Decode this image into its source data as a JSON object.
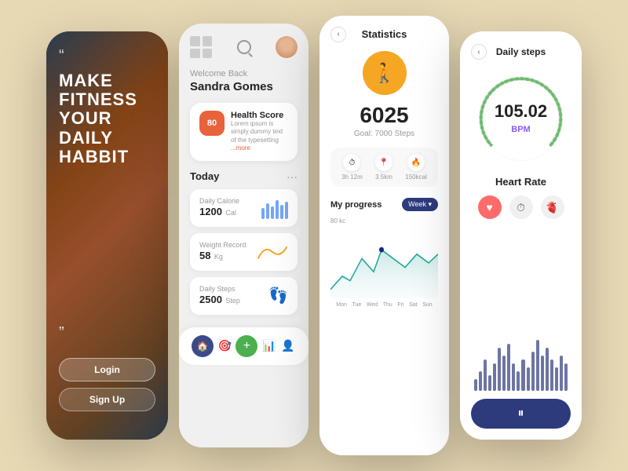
{
  "phone1": {
    "quote_open": "“",
    "quote_close": "”",
    "title_line1": "MAKE",
    "title_line2": "FITNESS",
    "title_line3": "YOUR DAILY",
    "title_line4": "HABBIT",
    "login_label": "Login",
    "signup_label": "Sign Up"
  },
  "phone2": {
    "welcome_text": "Welcome Back",
    "user_name": "Sandra Gomes",
    "health_score_value": "80",
    "health_title": "Health Score",
    "health_desc": "Lorem ipsum is simply dummy text of the typesetting",
    "more_link": "...more",
    "today_label": "Today",
    "calorie_label": "Daily Calorie",
    "calorie_value": "1200",
    "calorie_unit": "Cal",
    "weight_label": "Weight Record",
    "weight_value": "58",
    "weight_unit": "Kg",
    "steps_label": "Daily Steps",
    "steps_value": "2500",
    "steps_unit": "Step"
  },
  "phone3": {
    "title": "Statistics",
    "steps_count": "6025",
    "steps_goal": "Goal: 7000 Steps",
    "time_value": "3h 12m",
    "distance_value": "3.5km",
    "calories_value": "150kcal",
    "progress_title": "My progress",
    "week_label": "Week",
    "chart_value_label": "80 kc",
    "chart_days": [
      "Mon",
      "Tue",
      "Wed",
      "Thu",
      "Fri",
      "Sat",
      "Sun"
    ]
  },
  "phone4": {
    "title": "Daily steps",
    "bpm_value": "105.02",
    "bpm_label": "BPM",
    "heart_rate_title": "Heart Rate",
    "pause_icon": "⏸",
    "wave_heights": [
      15,
      25,
      40,
      20,
      35,
      55,
      45,
      60,
      35,
      25,
      40,
      30,
      50,
      65,
      45,
      55,
      40,
      30,
      45,
      35
    ]
  }
}
